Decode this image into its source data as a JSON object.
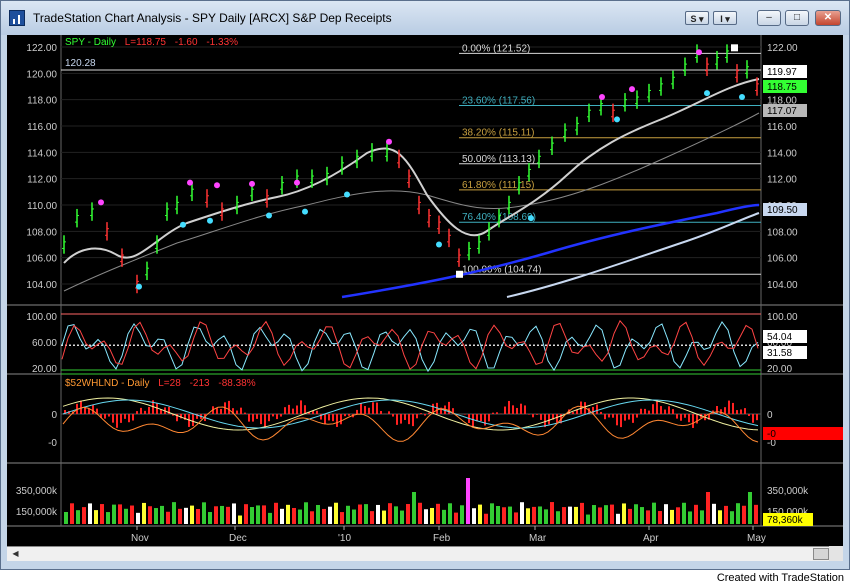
{
  "window": {
    "title": "TradeStation Chart Analysis - SPY Daily [ARCX] S&P Dep Receipts",
    "toolbar_btn_1": "S ▾",
    "toolbar_btn_2": "I ▾",
    "minimize": "–",
    "maximize": "□",
    "close": "✕"
  },
  "footer": {
    "credit": "Created with TradeStation"
  },
  "price_panel": {
    "legend": {
      "symbol": "SPY - Daily",
      "last": "L=118.75",
      "change": "-1.60",
      "change_pct": "-1.33%"
    },
    "y_ticks": [
      "122.00",
      "120.00",
      "118.00",
      "116.00",
      "114.00",
      "112.00",
      "110.00",
      "108.00",
      "106.00",
      "104.00"
    ],
    "ref_line_label": "120.28",
    "fib_levels": [
      {
        "label": "0.00% (121.52)",
        "value": 121.52,
        "color": "#d8d8d8"
      },
      {
        "label": "23.60% (117.56)",
        "value": 117.56,
        "color": "#3fb0c0"
      },
      {
        "label": "38.20% (115.11)",
        "value": 115.11,
        "color": "#c8a040"
      },
      {
        "label": "50.00% (113.13)",
        "value": 113.13,
        "color": "#d8d8d8"
      },
      {
        "label": "61.80% (111.15)",
        "value": 111.15,
        "color": "#c8a040"
      },
      {
        "label": "76.40% (108.69)",
        "value": 108.69,
        "color": "#3fb0c0"
      },
      {
        "label": "100.00% (104.74)",
        "value": 104.74,
        "color": "#d8d8d8"
      }
    ],
    "right_badges": [
      {
        "text": "119.97",
        "bg": "#ffffff",
        "fg": "#000000"
      },
      {
        "text": "118.75",
        "bg": "#33ff33",
        "fg": "#000000"
      },
      {
        "text": "117.07",
        "bg": "#b8b8b8",
        "fg": "#000000"
      },
      {
        "text": "109.50",
        "bg": "#c8d8f0",
        "fg": "#000000"
      }
    ]
  },
  "osc_panel": {
    "y_ticks": [
      "100.00",
      "60.00",
      "20.00"
    ],
    "badges": [
      {
        "text": "54.04",
        "bg": "#ffffff",
        "fg": "#000000"
      },
      {
        "text": "31.58",
        "bg": "#ffffff",
        "fg": "#000000"
      }
    ]
  },
  "breadth_panel": {
    "legend": {
      "symbol": "$52WHLND - Daily",
      "last": "L=28",
      "change": "-213",
      "change_pct": "-88.38%"
    },
    "y_ticks": [
      "0",
      "-0"
    ],
    "right_ticks": [
      "0",
      "-0"
    ],
    "badges": [
      {
        "text": "-0",
        "bg": "#ff0000",
        "fg": "#000000"
      }
    ]
  },
  "volume_panel": {
    "y_ticks": [
      "350,000k",
      "150,000k"
    ],
    "right_ticks": [
      "350,000k",
      "150,000k"
    ],
    "badges": [
      {
        "text": "78,360k",
        "bg": "#ffff00",
        "fg": "#000000"
      }
    ]
  },
  "x_axis": {
    "labels": [
      "Nov",
      "Dec",
      "'10",
      "Feb",
      "Mar",
      "Apr",
      "May"
    ]
  },
  "colors": {
    "background": "#000000",
    "up": "#33ff33",
    "down": "#ff2222",
    "grid": "#555555",
    "ma_blue": "#1a1aff",
    "ma_lightblue": "#c8d8f0"
  }
}
